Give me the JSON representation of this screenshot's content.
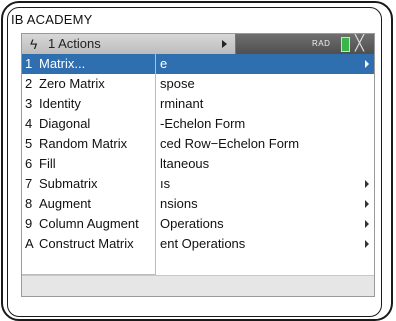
{
  "device": {
    "tag": "IB ACADEMY"
  },
  "topbar": {
    "bolt_icon": "lightning-icon",
    "actions_label": "1  Actions",
    "angle_mode": "RAD",
    "battery_color": "#39b54a",
    "close_glyph": "╳"
  },
  "menu": {
    "items": [
      {
        "key": "1",
        "label": "Matrix...",
        "selected": true
      },
      {
        "key": "2",
        "label": "Zero Matrix"
      },
      {
        "key": "3",
        "label": "Identity"
      },
      {
        "key": "4",
        "label": "Diagonal"
      },
      {
        "key": "5",
        "label": "Random Matrix"
      },
      {
        "key": "6",
        "label": "Fill"
      },
      {
        "key": "7",
        "label": "Submatrix"
      },
      {
        "key": "8",
        "label": "Augment"
      },
      {
        "key": "9",
        "label": "Column Augment"
      },
      {
        "key": "A",
        "label": "Construct Matrix"
      }
    ]
  },
  "submenu": {
    "items": [
      {
        "label": "e",
        "selected": true,
        "has_arrow": true
      },
      {
        "label": "spose"
      },
      {
        "label": "rminant"
      },
      {
        "label": "-Echelon Form"
      },
      {
        "label": "ced Row−Echelon Form"
      },
      {
        "label": "ltaneous"
      },
      {
        "label": "ıs",
        "has_arrow": true
      },
      {
        "label": "nsions",
        "has_arrow": true
      },
      {
        "label": "Operations",
        "has_arrow": true
      },
      {
        "label": "ent Operations",
        "has_arrow": true
      }
    ]
  },
  "colors": {
    "accent": "#2f6fb0"
  }
}
